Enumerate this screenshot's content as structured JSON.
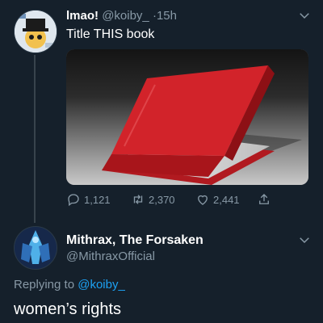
{
  "tweet": {
    "author_name": "lmao!",
    "author_handle": "@koiby_",
    "separator": "·",
    "time": "15h",
    "text": "Title THIS book",
    "media_description": "red book illustration",
    "actions": {
      "replies": "1,121",
      "retweets": "2,370",
      "likes": "2,441"
    }
  },
  "reply": {
    "author_name": "Mithrax, The Forsaken",
    "author_handle": "@MithraxOfficial",
    "replying_prefix": "Replying to",
    "replying_to": "@koiby_",
    "text": "women’s rights"
  },
  "colors": {
    "background": "#15202b",
    "text": "#ffffff",
    "secondary": "#8899a6",
    "link": "#1da1f2",
    "book_red": "#d2232a"
  }
}
